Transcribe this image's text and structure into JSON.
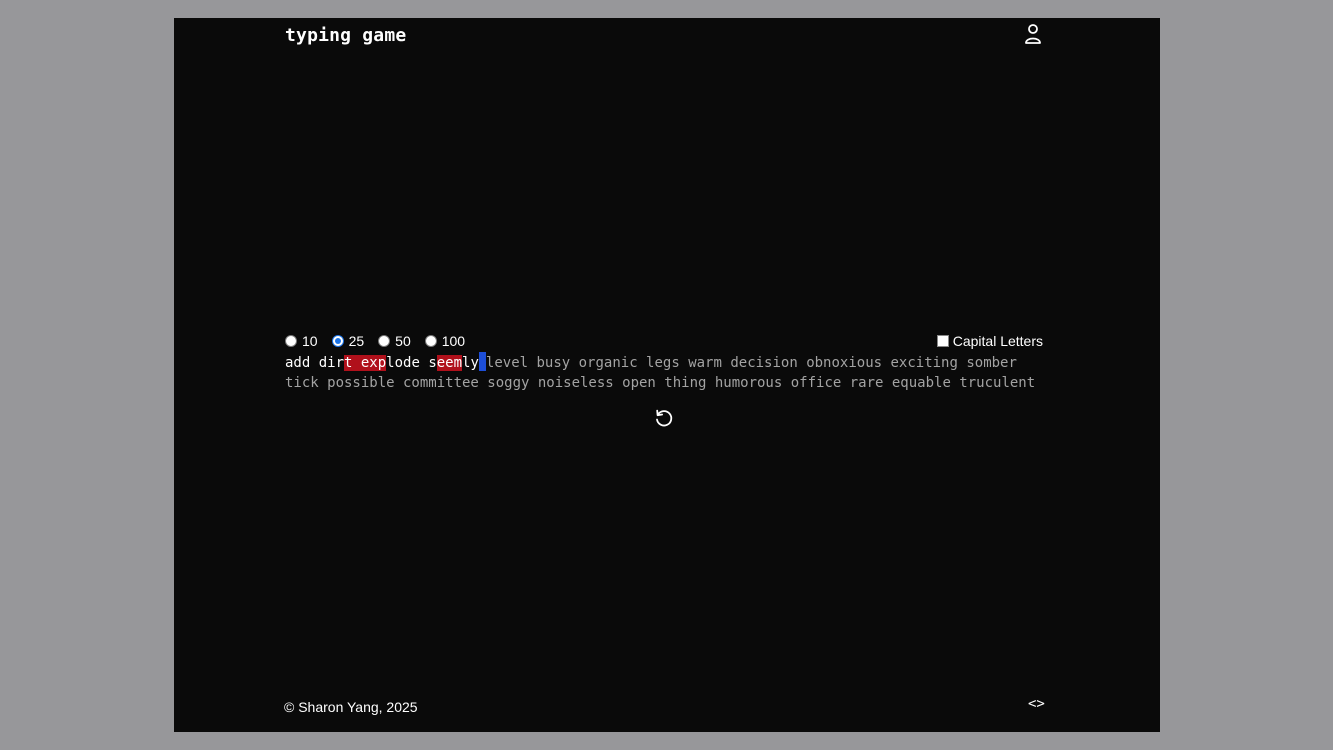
{
  "app": {
    "title": "typing game"
  },
  "header": {
    "user_icon": "user-icon"
  },
  "options": {
    "word_counts": [
      {
        "label": "10",
        "checked": false
      },
      {
        "label": "25",
        "checked": true
      },
      {
        "label": "50",
        "checked": false
      },
      {
        "label": "100",
        "checked": false
      }
    ],
    "capital_letters": {
      "label": "Capital Letters",
      "checked": false
    }
  },
  "typing": {
    "typed": [
      {
        "text": "add dir",
        "state": "correct"
      },
      {
        "text": "t ex",
        "state": "error"
      },
      {
        "text": "p",
        "state": "error"
      },
      {
        "text": "lode s",
        "state": "correct"
      },
      {
        "text": "eem",
        "state": "error"
      },
      {
        "text": "ly",
        "state": "correct"
      }
    ],
    "line1_remaining": "level busy organic legs warm decision obnoxious exciting somber",
    "line2": "tick possible committee soggy noiseless open thing humorous office rare equable truculent"
  },
  "restart_icon": "restart-icon",
  "footer": {
    "copyright": "© Sharon Yang, 2025",
    "code_icon": "code-icon",
    "code_glyph": "<>"
  },
  "colors": {
    "error_bg": "#b0101b",
    "caret": "#1d4ed8",
    "upcoming_text": "#a3a3a3",
    "background": "#0a0a0a"
  }
}
